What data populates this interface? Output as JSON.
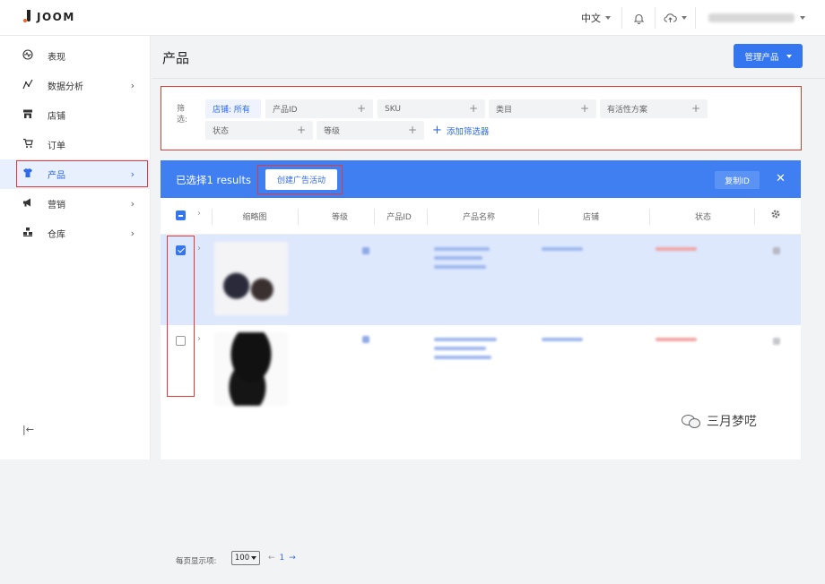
{
  "brand": {
    "name": "JOOM"
  },
  "topbar": {
    "language": "中文"
  },
  "sidebar": {
    "items": [
      {
        "label": "表现",
        "icon": "dashboard-icon",
        "has_children": false
      },
      {
        "label": "数据分析",
        "icon": "analytics-icon",
        "has_children": true
      },
      {
        "label": "店铺",
        "icon": "store-icon",
        "has_children": false
      },
      {
        "label": "订单",
        "icon": "cart-icon",
        "has_children": false
      },
      {
        "label": "产品",
        "icon": "tshirt-icon",
        "has_children": true,
        "active": true
      },
      {
        "label": "营销",
        "icon": "megaphone-icon",
        "has_children": true
      },
      {
        "label": "仓库",
        "icon": "warehouse-icon",
        "has_children": true
      }
    ]
  },
  "page": {
    "title": "产品",
    "manage_button": "管理产品"
  },
  "filters": {
    "label": "筛选:",
    "chips": [
      "店铺: 所有",
      "产品ID",
      "SKU",
      "类目",
      "有活性方案",
      "状态",
      "等级"
    ],
    "add_label": "添加筛选器"
  },
  "selection": {
    "text": "已选择1 results",
    "campaign_button": "创建广告活动",
    "copy_button": "复制ID"
  },
  "table": {
    "columns": [
      "缩略图",
      "等级",
      "产品ID",
      "产品名称",
      "店铺",
      "状态"
    ]
  },
  "pagination": {
    "label": "每页显示项:",
    "page_size": "100",
    "current": "1"
  },
  "watermark": {
    "text": "三月梦呓"
  },
  "colors": {
    "primary": "#3475f0",
    "highlight": "#e53935",
    "selected_row": "#dde8fd"
  }
}
